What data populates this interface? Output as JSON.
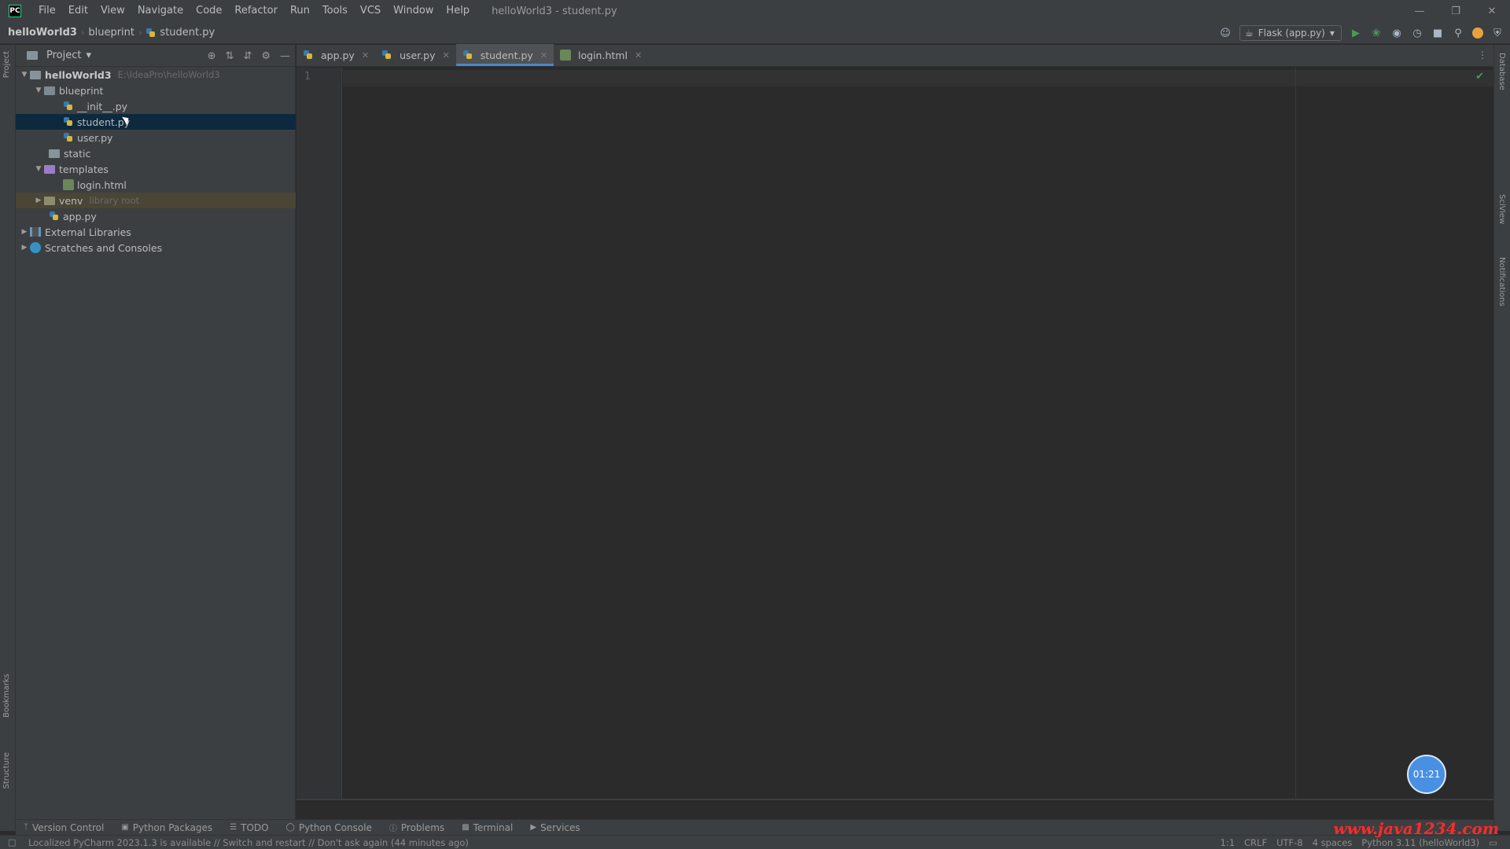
{
  "menu": {
    "items": [
      "File",
      "Edit",
      "View",
      "Navigate",
      "Code",
      "Refactor",
      "Run",
      "Tools",
      "VCS",
      "Window",
      "Help"
    ],
    "window_title": "helloWorld3 - student.py"
  },
  "breadcrumb": {
    "project": "helloWorld3",
    "folder": "blueprint",
    "file": "student.py"
  },
  "run_config": {
    "label": "Flask (app.py)"
  },
  "project_panel": {
    "title": "Project",
    "tree": [
      {
        "label": "helloWorld3",
        "hint": "E:\\IdeaPro\\helloWorld3"
      },
      {
        "label": "blueprint"
      },
      {
        "label": "__init__.py"
      },
      {
        "label": "student.py"
      },
      {
        "label": "user.py"
      },
      {
        "label": "static"
      },
      {
        "label": "templates"
      },
      {
        "label": "login.html"
      },
      {
        "label": "venv",
        "hint": "library root"
      },
      {
        "label": "app.py"
      },
      {
        "label": "External Libraries"
      },
      {
        "label": "Scratches and Consoles"
      }
    ]
  },
  "tabs": [
    "app.py",
    "user.py",
    "student.py",
    "login.html"
  ],
  "active_tab_index": 2,
  "editor": {
    "line_number": "1"
  },
  "timer": "01:21",
  "bottom_tools": [
    "Version Control",
    "Python Packages",
    "TODO",
    "Python Console",
    "Problems",
    "Terminal",
    "Services"
  ],
  "left_strip": {
    "top_label": "Project",
    "bottom_label_1": "Bookmarks",
    "bottom_label_2": "Structure"
  },
  "right_strip": {
    "label_1": "Database",
    "label_2": "SciView",
    "label_3": "Notifications"
  },
  "status": {
    "message": "Localized PyCharm 2023.1.3 is available // Switch and restart // Don't ask again (44 minutes ago)",
    "position": "1:1",
    "line_sep": "CRLF",
    "encoding": "UTF-8",
    "indent": "4 spaces",
    "interpreter": "Python 3.11 (helloWorld3)"
  },
  "watermark": "www.java1234.com",
  "colors": {
    "bg_editor": "#2b2b2b",
    "bg_panel": "#3c3f41",
    "selection": "#0d293e",
    "accent": "#4a88c7",
    "run_green": "#499c54",
    "watermark_red": "#ff2a2a"
  }
}
